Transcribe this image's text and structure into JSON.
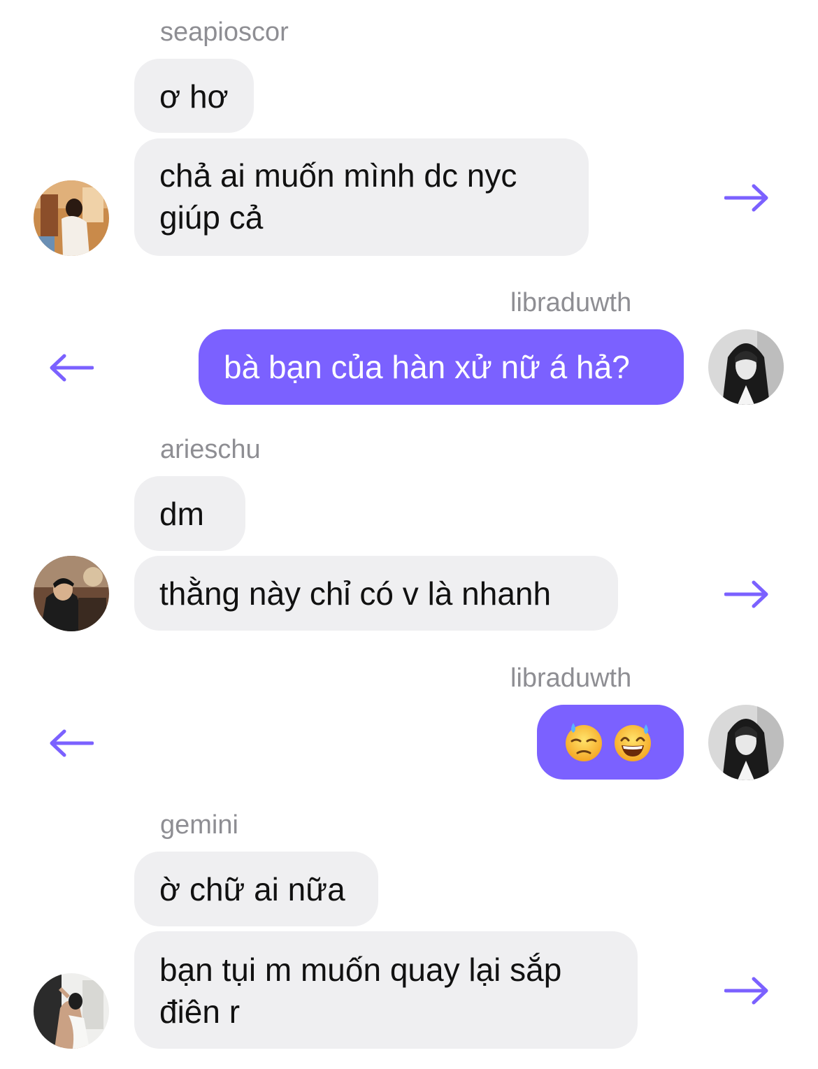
{
  "messages": [
    {
      "sender": "seapioscor",
      "bubbles": [
        "ơ hơ",
        "chả ai muốn mình dc nyc giúp cả"
      ]
    },
    {
      "sender": "libraduwth",
      "bubbles": [
        "bà bạn của hàn xử nữ á hả?"
      ]
    },
    {
      "sender": "arieschu",
      "bubbles": [
        "dm",
        "thằng này chỉ có v là nhanh"
      ]
    },
    {
      "sender": "libraduwth",
      "emojis": [
        "downcast-face-with-sweat-icon",
        "grinning-face-with-sweat-icon"
      ]
    },
    {
      "sender": "gemini",
      "bubbles": [
        "ờ chữ ai nữa",
        "bạn tụi m muốn quay lại sắp điên r"
      ]
    }
  ],
  "colors": {
    "accent": "#7b61ff",
    "incoming_bubble": "#efeff1",
    "sender_text": "#8e8e93"
  }
}
